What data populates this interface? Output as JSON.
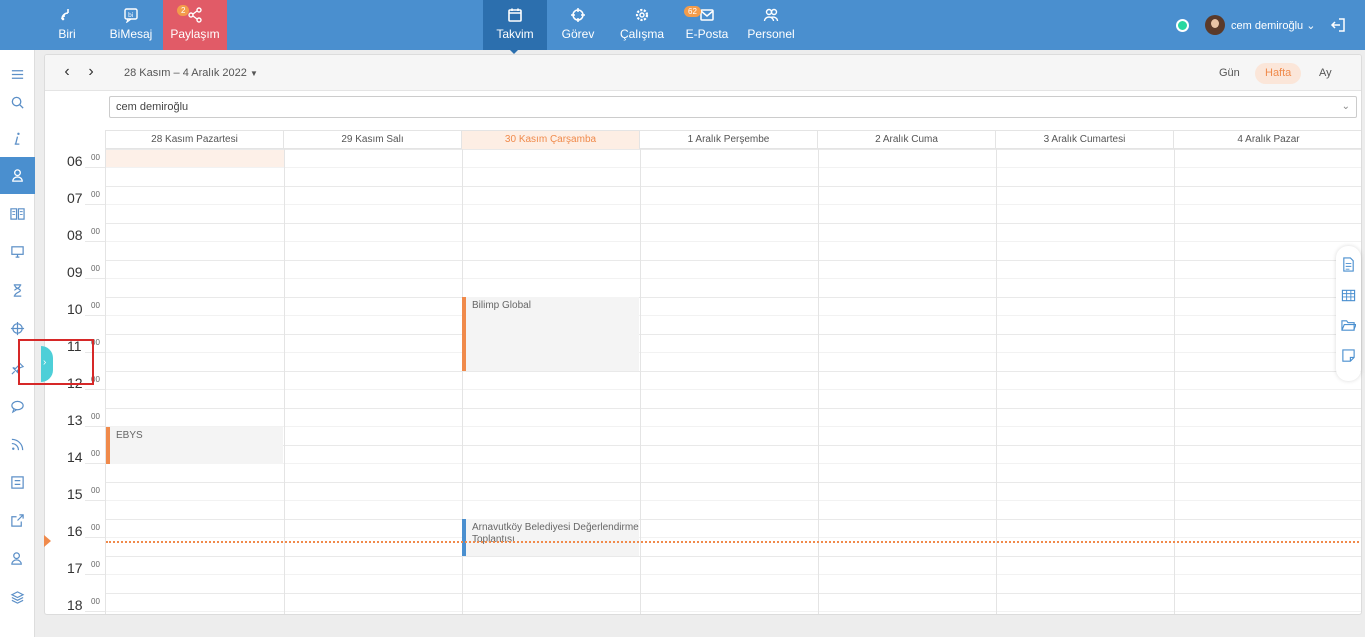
{
  "topbar": {
    "left_items": [
      {
        "label": "Biri",
        "icon": "biri-icon"
      },
      {
        "label": "BiMesaj",
        "icon": "bimesaj-icon"
      },
      {
        "label": "Paylaşım",
        "icon": "share-icon",
        "badge": "2"
      }
    ],
    "center_items": [
      {
        "label": "Takvim",
        "icon": "calendar-icon"
      },
      {
        "label": "Görev",
        "icon": "target-icon"
      },
      {
        "label": "Çalışma",
        "icon": "gear-icon"
      },
      {
        "label": "E-Posta",
        "icon": "mail-icon",
        "badge": "62"
      },
      {
        "label": "Personel",
        "icon": "people-icon"
      }
    ],
    "user_name": "cem demiroğlu",
    "colors": {
      "bar": "#4a8fcf",
      "active_red": "#e15b67",
      "active_blue": "#2c6fae",
      "badge": "#f39c4b"
    }
  },
  "sidebar": {
    "icons": [
      "menu-icon",
      "search-icon",
      "info-icon",
      "user-icon",
      "book-icon",
      "monitor-icon",
      "hourglass-icon",
      "crosshair-icon",
      "pin-icon",
      "chat-icon",
      "rss-icon",
      "list-icon",
      "share-out-icon",
      "user-group-icon",
      "layers-icon"
    ]
  },
  "calendar": {
    "date_range": "28 Kasım – 4 Aralık 2022",
    "views": {
      "day": "Gün",
      "week": "Hafta",
      "month": "Ay"
    },
    "selected_user": "cem demiroğlu",
    "days": [
      "28 Kasım Pazartesi",
      "29 Kasım Salı",
      "30 Kasım Çarşamba",
      "1 Aralık Perşembe",
      "2 Aralık Cuma",
      "3 Aralık Cumartesi",
      "4 Aralık Pazar"
    ],
    "today_index": 2,
    "hours": [
      "06",
      "07",
      "08",
      "09",
      "10",
      "11",
      "12",
      "13",
      "14",
      "15",
      "16",
      "17",
      "18"
    ],
    "minute_label": "00",
    "events": [
      {
        "title": "Bilimp Global",
        "day": 2,
        "start": 10,
        "end": 12,
        "color": "#f08a4b"
      },
      {
        "title": "EBYS",
        "day": 0,
        "start": 13.5,
        "end": 14.5,
        "color": "#f08a4b"
      },
      {
        "title": "Arnavutköy Belediyesi Değerlendirme Toplantısı",
        "day": 2,
        "start": 16,
        "end": 17,
        "color": "#4a8fcf"
      }
    ],
    "now_hour": 16.6
  },
  "right_tools": [
    "document-icon",
    "table-icon",
    "folder-icon",
    "note-icon"
  ]
}
